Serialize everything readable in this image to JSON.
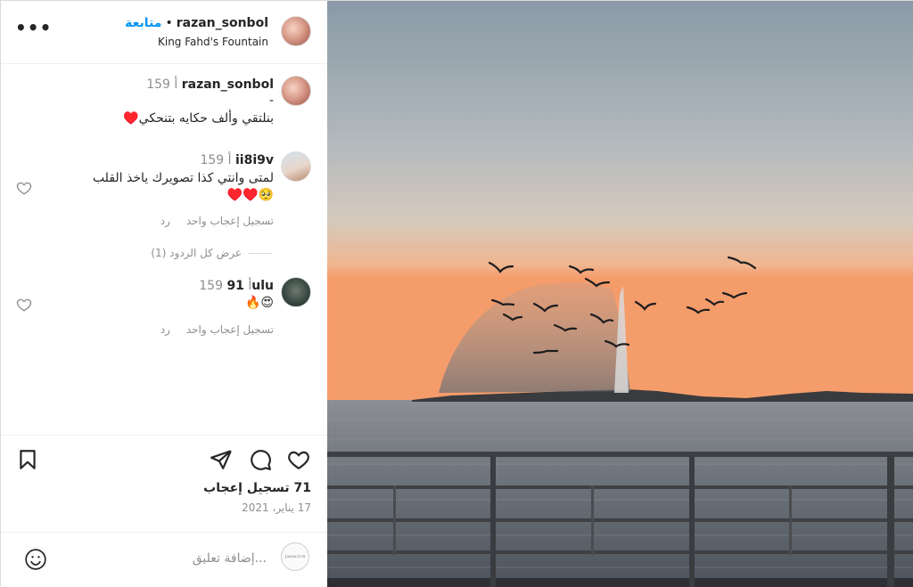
{
  "header": {
    "username": "razan_sonbol",
    "follow_label": "متابعة",
    "separator": "•",
    "location": "King Fahd's Fountain",
    "more_label": "•••"
  },
  "caption": {
    "username": "razan_sonbol",
    "time": "159 أ",
    "dash": "-",
    "text": "بنلتقي وألف حكايه بتنحكي♥️"
  },
  "comments": [
    {
      "username": "ii8i9v",
      "time": "159 أ",
      "line1": "لمتى وانتي كذا تصويرك ياخذ القلب",
      "line2": "🥺♥️♥️",
      "like_label": "تسجيل إعجاب واحد",
      "reply_label": "رد",
      "view_replies": "عرض كل الردود (1)"
    },
    {
      "username": "91ulu",
      "time": "159 أ",
      "line1": "😍🔥",
      "like_label": "تسجيل إعجاب واحد",
      "reply_label": "رد"
    }
  ],
  "likes_text": "71 تسجيل إعجاب",
  "date_text": "17 يناير، 2021",
  "add_comment": {
    "placeholder": "إضافة تعليق...",
    "avatar_text": "JAWALTUB"
  },
  "icons": {
    "more": "more-icon",
    "heart": "heart-icon",
    "comment": "comment-icon",
    "share": "share-icon",
    "save": "bookmark-icon",
    "emoji": "emoji-icon"
  },
  "colors": {
    "accent": "#0095f6",
    "text": "#262626",
    "muted": "#8e8e8e",
    "divider": "#efefef"
  }
}
